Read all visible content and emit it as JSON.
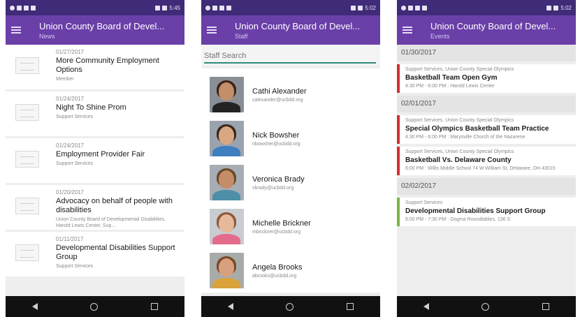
{
  "status_times": [
    "5:45",
    "5:02",
    "5:02"
  ],
  "app_title": "Union County Board of Devel...",
  "colors": {
    "appbar": "#6a3fa8",
    "statusbar": "#3f2b78",
    "red_bar": "#d32f2f",
    "green_bar": "#7cb342",
    "search_underline": "#2e8b7a"
  },
  "news": {
    "subtitle": "News",
    "items": [
      {
        "date": "01/27/2017",
        "title": "More Community Employment Options",
        "category": "Member"
      },
      {
        "date": "01/24/2017",
        "title": "Night To Shine Prom",
        "category": "Support Services"
      },
      {
        "date": "01/24/2017",
        "title": "Employment Provider Fair",
        "category": "Support Services"
      },
      {
        "date": "01/20/2017",
        "title": "Advocacy on behalf of people with disabilities",
        "category": "Union County Board of Developmental Disabilities, Harold Lewis Center, Sup..."
      },
      {
        "date": "01/11/2017",
        "title": "Developmental Disabilities Support Group",
        "category": "Support Services"
      }
    ]
  },
  "staff": {
    "subtitle": "Staff",
    "search_placeholder": "Staff Search",
    "people": [
      {
        "name": "Cathi Alexander",
        "email": "calexander@ucbdd.org",
        "skin": "#c58e6a",
        "hair": "#3b2416",
        "shirt": "#232323",
        "bg": "#8a8f97"
      },
      {
        "name": "Nick Bowsher",
        "email": "nbowsher@ucbdd.org",
        "skin": "#d9a883",
        "hair": "#3a2a1c",
        "shirt": "#3f7fc0",
        "bg": "#9aa3ae"
      },
      {
        "name": "Veronica Brady",
        "email": "vbrady@ucbdd.org",
        "skin": "#c48d67",
        "hair": "#6a4a2a",
        "shirt": "#4d8fa8",
        "bg": "#a7adb5"
      },
      {
        "name": "Michelle Brickner",
        "email": "mbrickner@ucbdd.org",
        "skin": "#e6b99a",
        "hair": "#8a5b3a",
        "shirt": "#e56b8c",
        "bg": "#c9ccd1"
      },
      {
        "name": "Angela Brooks",
        "email": "abrooks@ucbdd.org",
        "skin": "#d8a07e",
        "hair": "#7a4a2a",
        "shirt": "#d9a23a",
        "bg": "#a8aca8"
      }
    ]
  },
  "events": {
    "subtitle": "Events",
    "groups": [
      {
        "date": "01/30/2017",
        "items": [
          {
            "category": "Support Services, Union County Special Olympics",
            "title": "Basketball Team Open Gym",
            "time": "4:30 PM - 6:00 PM : Harold Lewis Center",
            "color": "#d32f2f"
          }
        ]
      },
      {
        "date": "02/01/2017",
        "items": [
          {
            "category": "Support Services, Union County Special Olympics",
            "title": "Special Olympics Basketball Team Practice",
            "time": "4:30 PM - 6:00 PM : Marysville Church of the Nazarene",
            "color": "#d32f2f"
          },
          {
            "category": "Support Services, Union County Special Olympics",
            "title": "Basketball Vs. Delaware County",
            "time": "6:00 PM : Willis Middle School 74 W William St, Delaware, OH 43015",
            "color": "#d32f2f"
          }
        ]
      },
      {
        "date": "02/02/2017",
        "items": [
          {
            "category": "Support Services",
            "title": "Developmental Disabilities Support Group",
            "time": "6:00 PM - 7:30 PM : Dogma Roundtables, 136 S",
            "color": "#7cb342"
          }
        ]
      }
    ]
  }
}
